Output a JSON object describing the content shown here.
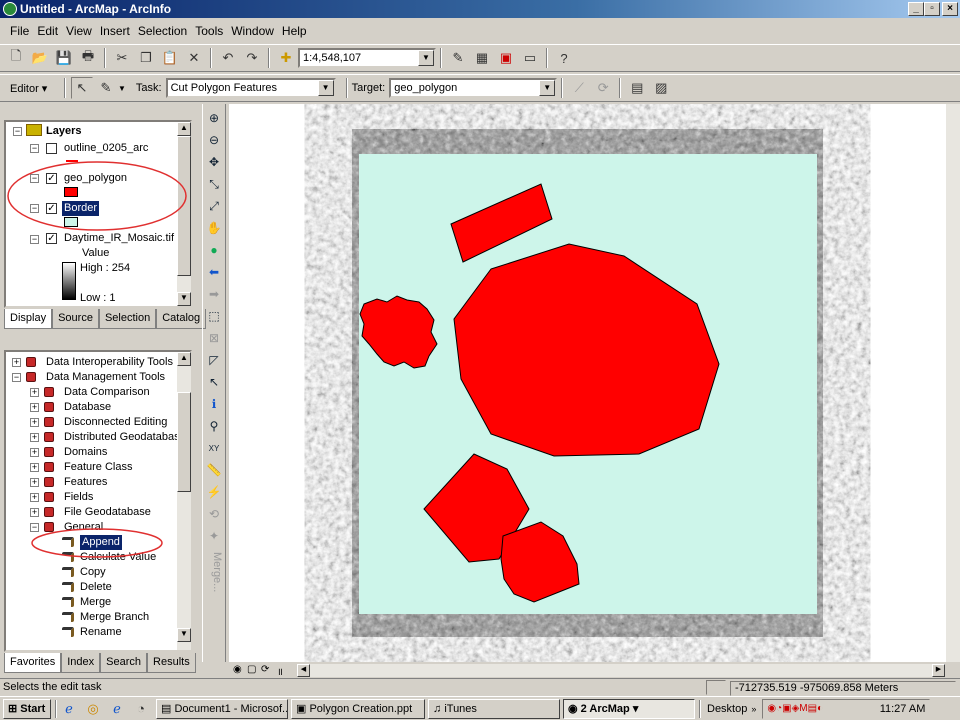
{
  "window": {
    "title": "Untitled - ArcMap - ArcInfo"
  },
  "menu": [
    "File",
    "Edit",
    "View",
    "Insert",
    "Selection",
    "Tools",
    "Window",
    "Help"
  ],
  "standard_toolbar": {
    "scale": "1:4,548,107"
  },
  "editor_toolbar": {
    "editor_label": "Editor",
    "task_label": "Task:",
    "task_value": "Cut Polygon Features",
    "target_label": "Target:",
    "target_value": "geo_polygon"
  },
  "toc": {
    "root": "Layers",
    "layers": [
      {
        "name": "outline_0205_arc",
        "checked": false
      },
      {
        "name": "geo_polygon",
        "checked": true,
        "swatch": "#ff0000"
      },
      {
        "name": "Border",
        "checked": true,
        "swatch": "#cdf5ea"
      },
      {
        "name": "Daytime_IR_Mosaic.tif",
        "checked": true
      }
    ],
    "raster_legend": {
      "value": "Value",
      "high": "High : 254",
      "low": "Low : 1"
    },
    "tabs": [
      "Display",
      "Source",
      "Selection",
      "Catalog"
    ]
  },
  "toolbox": {
    "items": [
      {
        "label": "Data Interoperability Tools",
        "level": 0,
        "expand": "+"
      },
      {
        "label": "Data Management Tools",
        "level": 0,
        "expand": "-"
      },
      {
        "label": "Data Comparison",
        "level": 1,
        "expand": "+"
      },
      {
        "label": "Database",
        "level": 1,
        "expand": "+"
      },
      {
        "label": "Disconnected Editing",
        "level": 1,
        "expand": "+"
      },
      {
        "label": "Distributed Geodatabase",
        "level": 1,
        "expand": "+"
      },
      {
        "label": "Domains",
        "level": 1,
        "expand": "+"
      },
      {
        "label": "Feature Class",
        "level": 1,
        "expand": "+"
      },
      {
        "label": "Features",
        "level": 1,
        "expand": "+"
      },
      {
        "label": "Fields",
        "level": 1,
        "expand": "+"
      },
      {
        "label": "File Geodatabase",
        "level": 1,
        "expand": "+"
      },
      {
        "label": "General",
        "level": 1,
        "expand": "-"
      },
      {
        "label": "Append",
        "level": 2,
        "selected": true
      },
      {
        "label": "Calculate Value",
        "level": 2
      },
      {
        "label": "Copy",
        "level": 2
      },
      {
        "label": "Delete",
        "level": 2
      },
      {
        "label": "Merge",
        "level": 2
      },
      {
        "label": "Merge Branch",
        "level": 2
      },
      {
        "label": "Rename",
        "level": 2
      }
    ],
    "tabs": [
      "Favorites",
      "Index",
      "Search",
      "Results"
    ]
  },
  "vertical_toolbar": {
    "label": "Merge..."
  },
  "status": {
    "message": "Selects the edit task",
    "coords": "-712735.519  -975069.858 Meters"
  },
  "taskbar": {
    "start": "Start",
    "tasks": [
      "Document1 - Microsof...",
      "Polygon Creation.ppt",
      "iTunes",
      "2 ArcMap"
    ],
    "desktop": "Desktop",
    "clock": "11:27 AM"
  },
  "colors": {
    "polygon_fill": "#ff0000",
    "border_fill": "#cdf5ea",
    "title_bar": "#0a246a",
    "annotation_circle": "#e03030"
  }
}
